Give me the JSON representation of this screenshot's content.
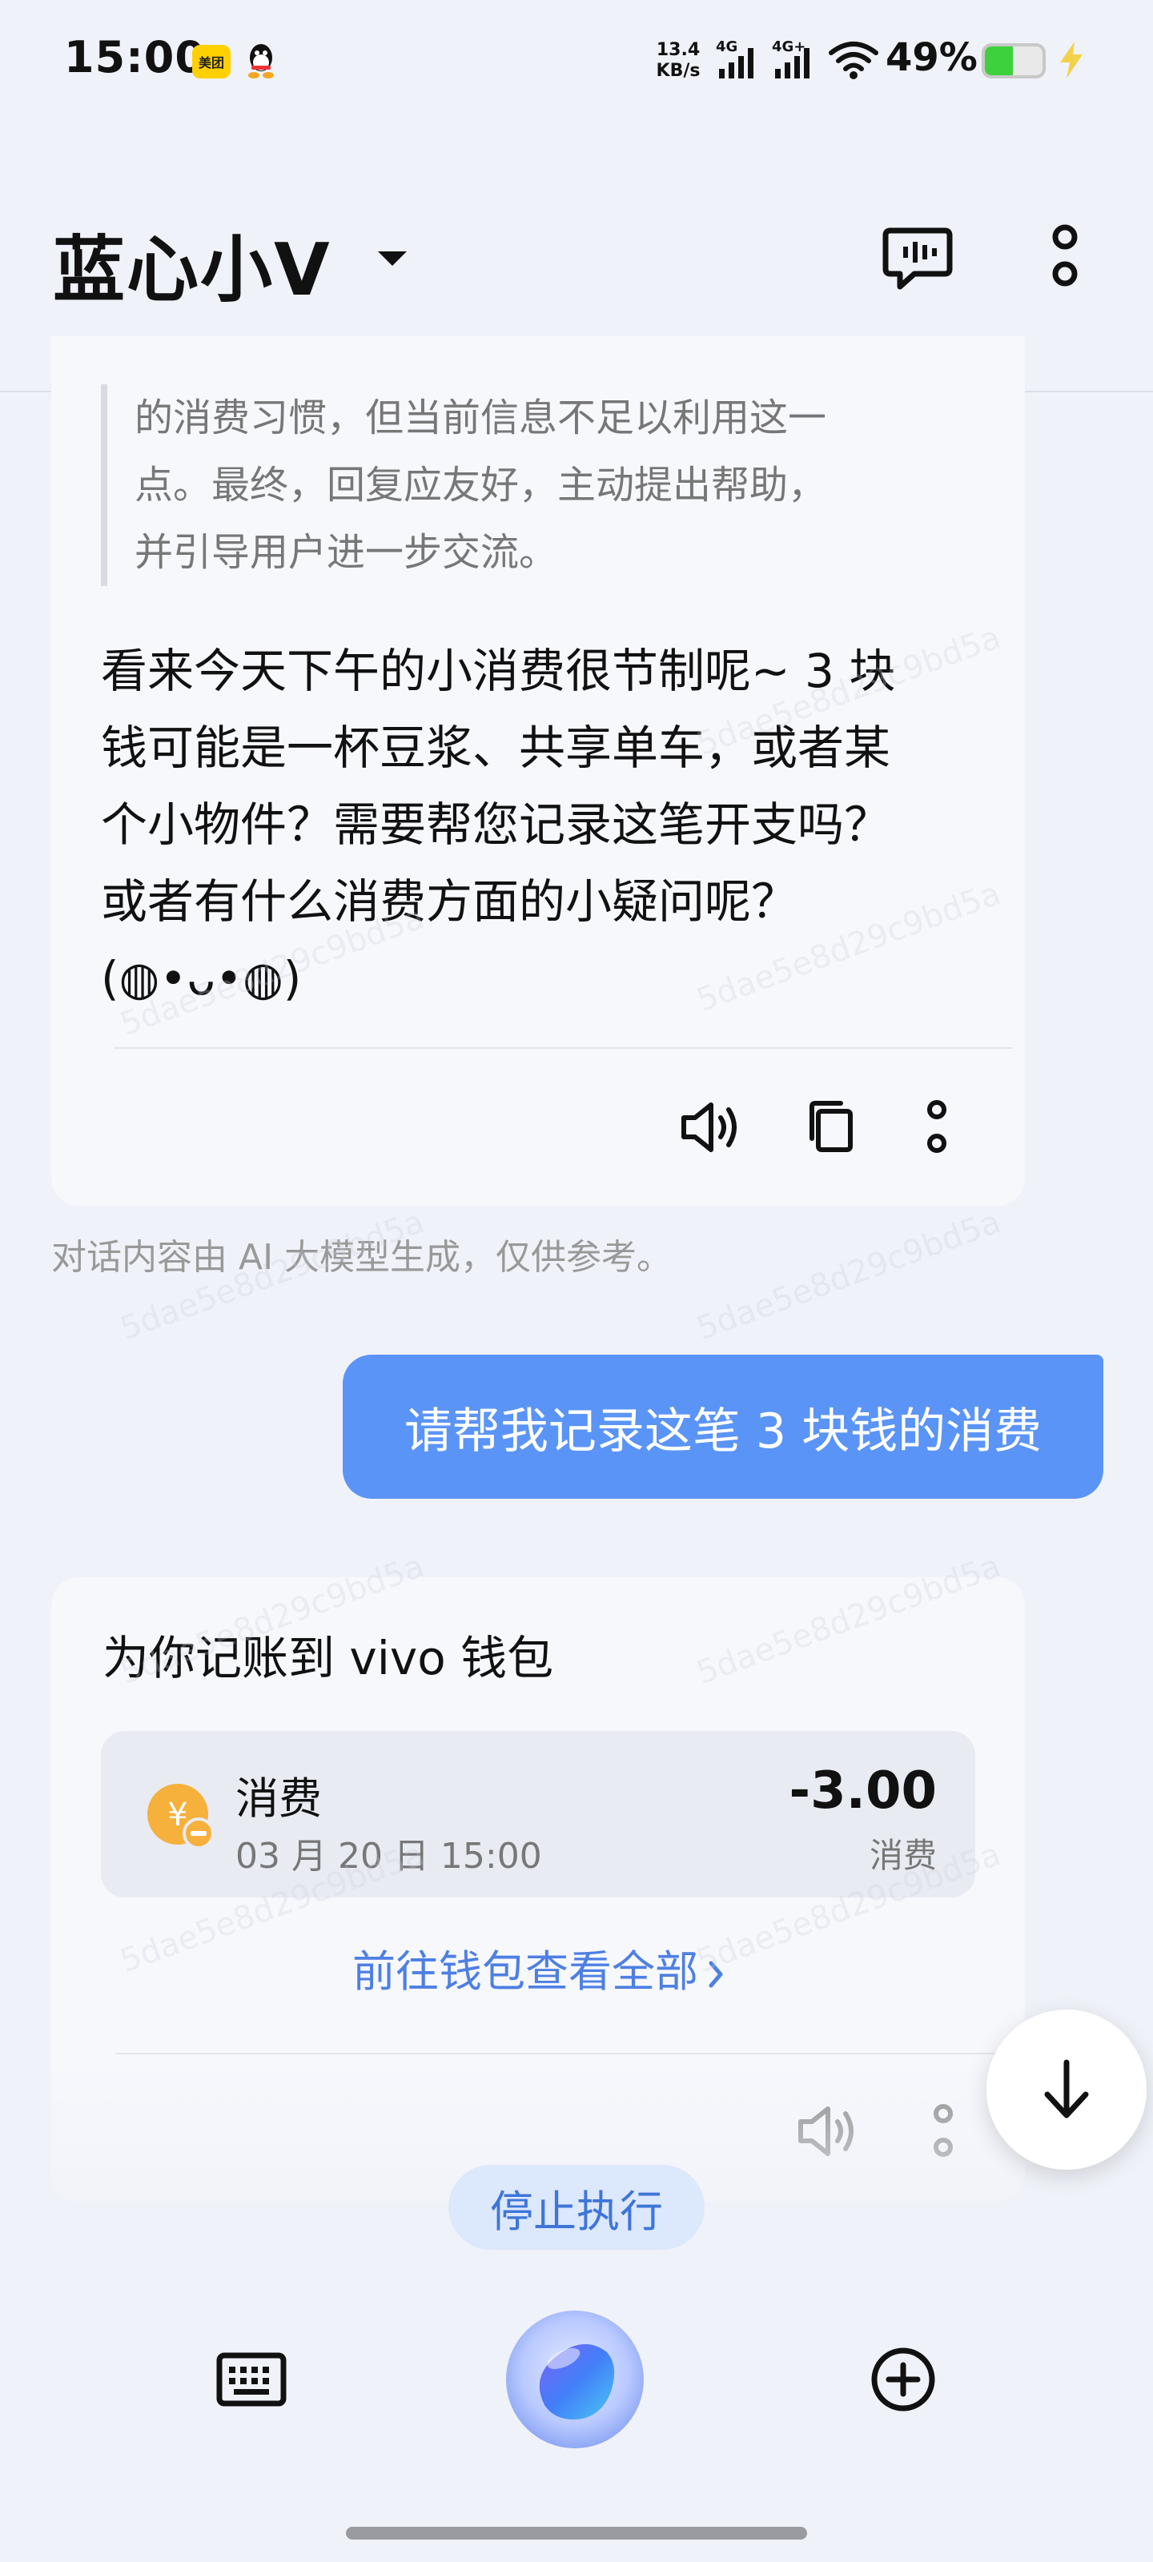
{
  "status_bar": {
    "time": "15:00",
    "app_badges": [
      "美团"
    ],
    "net_speed_value": "13.4",
    "net_speed_unit": "KB/s",
    "signal_1": "4G",
    "signal_2": "4G+",
    "battery_percent": "49%",
    "battery_level": 0.49,
    "battery_color": "#3dd13d",
    "charging": true
  },
  "header": {
    "title": "蓝心小V",
    "icons": [
      "chevron-down-icon",
      "chat-voice-icon",
      "more-vertical-icon"
    ]
  },
  "ai_message": {
    "thinking_lines": [
      "的消费习惯，但当前信息不足以利用这一",
      "点。最终，回复应友好，主动提出帮助，",
      "并引导用户进一步交流。"
    ],
    "reply_lines": [
      "看来今天下午的小消费很节制呢~ 3 块",
      "钱可能是一杯豆浆、共享单车，或者某",
      "个小物件？需要帮您记录这笔开支吗？",
      "或者有什么消费方面的小疑问呢？",
      "(◍•ᴗ•◍)"
    ],
    "actions": [
      "speaker-icon",
      "copy-icon",
      "more-vertical-icon"
    ]
  },
  "disclaimer": "对话内容由 AI 大模型生成，仅供参考。",
  "user_message": "请帮我记录这笔 3 块钱的消费",
  "wallet_card": {
    "heading": "为你记账到 vivo 钱包",
    "transaction": {
      "name": "消费",
      "date": "03 月 20 日 15:00",
      "amount": "-3.00",
      "type": "消费",
      "icon": "yuan-minus-icon",
      "icon_color": "#f6b03c"
    },
    "link_label": "前往钱包查看全部",
    "actions": [
      "speaker-icon",
      "more-vertical-icon"
    ]
  },
  "stop_button": "停止执行",
  "bottom_bar": {
    "icons": [
      "keyboard-icon",
      "voice-orb-icon",
      "plus-circle-icon"
    ]
  },
  "watermark": "5dae5e8d29c9bd5a",
  "accent_color": "#5b94f7"
}
